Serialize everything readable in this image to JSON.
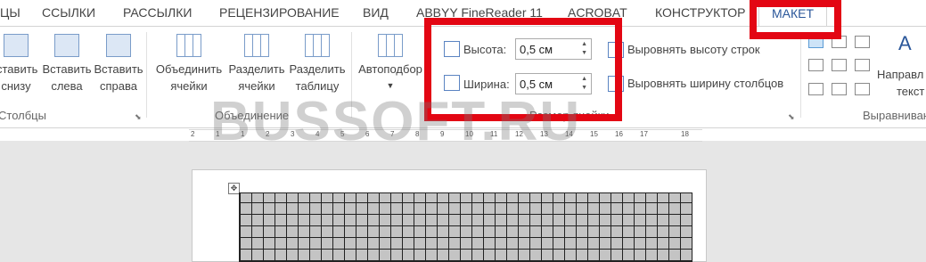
{
  "tabs": [
    "ЦЫ",
    "ССЫЛКИ",
    "РАССЫЛКИ",
    "РЕЦЕНЗИРОВАНИЕ",
    "ВИД",
    "ABBYY FineReader 11",
    "ACROBAT",
    "КОНСТРУКТОР",
    "МАКЕТ"
  ],
  "groups": {
    "rows_cols": {
      "label": "Столбцы",
      "btn1": [
        "ставить",
        "снизу"
      ],
      "btn2": [
        "Вставить",
        "слева"
      ],
      "btn3": [
        "Вставить",
        "справа"
      ]
    },
    "merge": {
      "label": "Объединение",
      "btn1": [
        "Объединить",
        "ячейки"
      ],
      "btn2": [
        "Разделить",
        "ячейки"
      ],
      "btn3": [
        "Разделить",
        "таблицу"
      ]
    },
    "cell_size": {
      "label": "Размер ячейки",
      "autofit": "Автоподбор",
      "height_label": "Высота:",
      "height_value": "0,5 см",
      "width_label": "Ширина:",
      "width_value": "0,5 см",
      "distribute_rows": "Выровнять высоту строк",
      "distribute_cols": "Выровнять ширину столбцов"
    },
    "alignment": {
      "label": "Выравниван",
      "direction": [
        "Направл",
        "текст"
      ]
    }
  },
  "ruler": {
    "ticks": [
      "2",
      "1",
      "1",
      "2",
      "3",
      "4",
      "5",
      "6",
      "7",
      "8",
      "9",
      "10",
      "11",
      "12",
      "13",
      "14",
      "15",
      "16",
      "17",
      "18"
    ]
  },
  "watermark": "BUSSOFT.RU",
  "colors": {
    "accent": "#2b579a",
    "highlight": "#e30613"
  }
}
